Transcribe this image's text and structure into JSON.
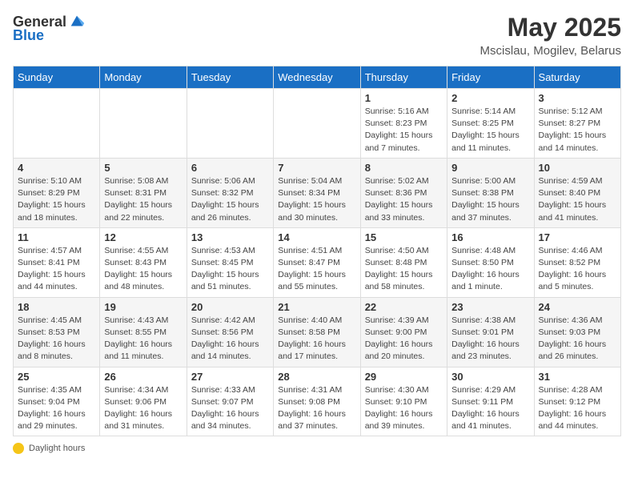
{
  "header": {
    "logo_general": "General",
    "logo_blue": "Blue",
    "month": "May 2025",
    "location": "Mscislau, Mogilev, Belarus"
  },
  "days_of_week": [
    "Sunday",
    "Monday",
    "Tuesday",
    "Wednesday",
    "Thursday",
    "Friday",
    "Saturday"
  ],
  "weeks": [
    [
      {
        "day": "",
        "info": ""
      },
      {
        "day": "",
        "info": ""
      },
      {
        "day": "",
        "info": ""
      },
      {
        "day": "",
        "info": ""
      },
      {
        "day": "1",
        "info": "Sunrise: 5:16 AM\nSunset: 8:23 PM\nDaylight: 15 hours\nand 7 minutes."
      },
      {
        "day": "2",
        "info": "Sunrise: 5:14 AM\nSunset: 8:25 PM\nDaylight: 15 hours\nand 11 minutes."
      },
      {
        "day": "3",
        "info": "Sunrise: 5:12 AM\nSunset: 8:27 PM\nDaylight: 15 hours\nand 14 minutes."
      }
    ],
    [
      {
        "day": "4",
        "info": "Sunrise: 5:10 AM\nSunset: 8:29 PM\nDaylight: 15 hours\nand 18 minutes."
      },
      {
        "day": "5",
        "info": "Sunrise: 5:08 AM\nSunset: 8:31 PM\nDaylight: 15 hours\nand 22 minutes."
      },
      {
        "day": "6",
        "info": "Sunrise: 5:06 AM\nSunset: 8:32 PM\nDaylight: 15 hours\nand 26 minutes."
      },
      {
        "day": "7",
        "info": "Sunrise: 5:04 AM\nSunset: 8:34 PM\nDaylight: 15 hours\nand 30 minutes."
      },
      {
        "day": "8",
        "info": "Sunrise: 5:02 AM\nSunset: 8:36 PM\nDaylight: 15 hours\nand 33 minutes."
      },
      {
        "day": "9",
        "info": "Sunrise: 5:00 AM\nSunset: 8:38 PM\nDaylight: 15 hours\nand 37 minutes."
      },
      {
        "day": "10",
        "info": "Sunrise: 4:59 AM\nSunset: 8:40 PM\nDaylight: 15 hours\nand 41 minutes."
      }
    ],
    [
      {
        "day": "11",
        "info": "Sunrise: 4:57 AM\nSunset: 8:41 PM\nDaylight: 15 hours\nand 44 minutes."
      },
      {
        "day": "12",
        "info": "Sunrise: 4:55 AM\nSunset: 8:43 PM\nDaylight: 15 hours\nand 48 minutes."
      },
      {
        "day": "13",
        "info": "Sunrise: 4:53 AM\nSunset: 8:45 PM\nDaylight: 15 hours\nand 51 minutes."
      },
      {
        "day": "14",
        "info": "Sunrise: 4:51 AM\nSunset: 8:47 PM\nDaylight: 15 hours\nand 55 minutes."
      },
      {
        "day": "15",
        "info": "Sunrise: 4:50 AM\nSunset: 8:48 PM\nDaylight: 15 hours\nand 58 minutes."
      },
      {
        "day": "16",
        "info": "Sunrise: 4:48 AM\nSunset: 8:50 PM\nDaylight: 16 hours\nand 1 minute."
      },
      {
        "day": "17",
        "info": "Sunrise: 4:46 AM\nSunset: 8:52 PM\nDaylight: 16 hours\nand 5 minutes."
      }
    ],
    [
      {
        "day": "18",
        "info": "Sunrise: 4:45 AM\nSunset: 8:53 PM\nDaylight: 16 hours\nand 8 minutes."
      },
      {
        "day": "19",
        "info": "Sunrise: 4:43 AM\nSunset: 8:55 PM\nDaylight: 16 hours\nand 11 minutes."
      },
      {
        "day": "20",
        "info": "Sunrise: 4:42 AM\nSunset: 8:56 PM\nDaylight: 16 hours\nand 14 minutes."
      },
      {
        "day": "21",
        "info": "Sunrise: 4:40 AM\nSunset: 8:58 PM\nDaylight: 16 hours\nand 17 minutes."
      },
      {
        "day": "22",
        "info": "Sunrise: 4:39 AM\nSunset: 9:00 PM\nDaylight: 16 hours\nand 20 minutes."
      },
      {
        "day": "23",
        "info": "Sunrise: 4:38 AM\nSunset: 9:01 PM\nDaylight: 16 hours\nand 23 minutes."
      },
      {
        "day": "24",
        "info": "Sunrise: 4:36 AM\nSunset: 9:03 PM\nDaylight: 16 hours\nand 26 minutes."
      }
    ],
    [
      {
        "day": "25",
        "info": "Sunrise: 4:35 AM\nSunset: 9:04 PM\nDaylight: 16 hours\nand 29 minutes."
      },
      {
        "day": "26",
        "info": "Sunrise: 4:34 AM\nSunset: 9:06 PM\nDaylight: 16 hours\nand 31 minutes."
      },
      {
        "day": "27",
        "info": "Sunrise: 4:33 AM\nSunset: 9:07 PM\nDaylight: 16 hours\nand 34 minutes."
      },
      {
        "day": "28",
        "info": "Sunrise: 4:31 AM\nSunset: 9:08 PM\nDaylight: 16 hours\nand 37 minutes."
      },
      {
        "day": "29",
        "info": "Sunrise: 4:30 AM\nSunset: 9:10 PM\nDaylight: 16 hours\nand 39 minutes."
      },
      {
        "day": "30",
        "info": "Sunrise: 4:29 AM\nSunset: 9:11 PM\nDaylight: 16 hours\nand 41 minutes."
      },
      {
        "day": "31",
        "info": "Sunrise: 4:28 AM\nSunset: 9:12 PM\nDaylight: 16 hours\nand 44 minutes."
      }
    ]
  ],
  "footer": {
    "daylight_label": "Daylight hours"
  }
}
